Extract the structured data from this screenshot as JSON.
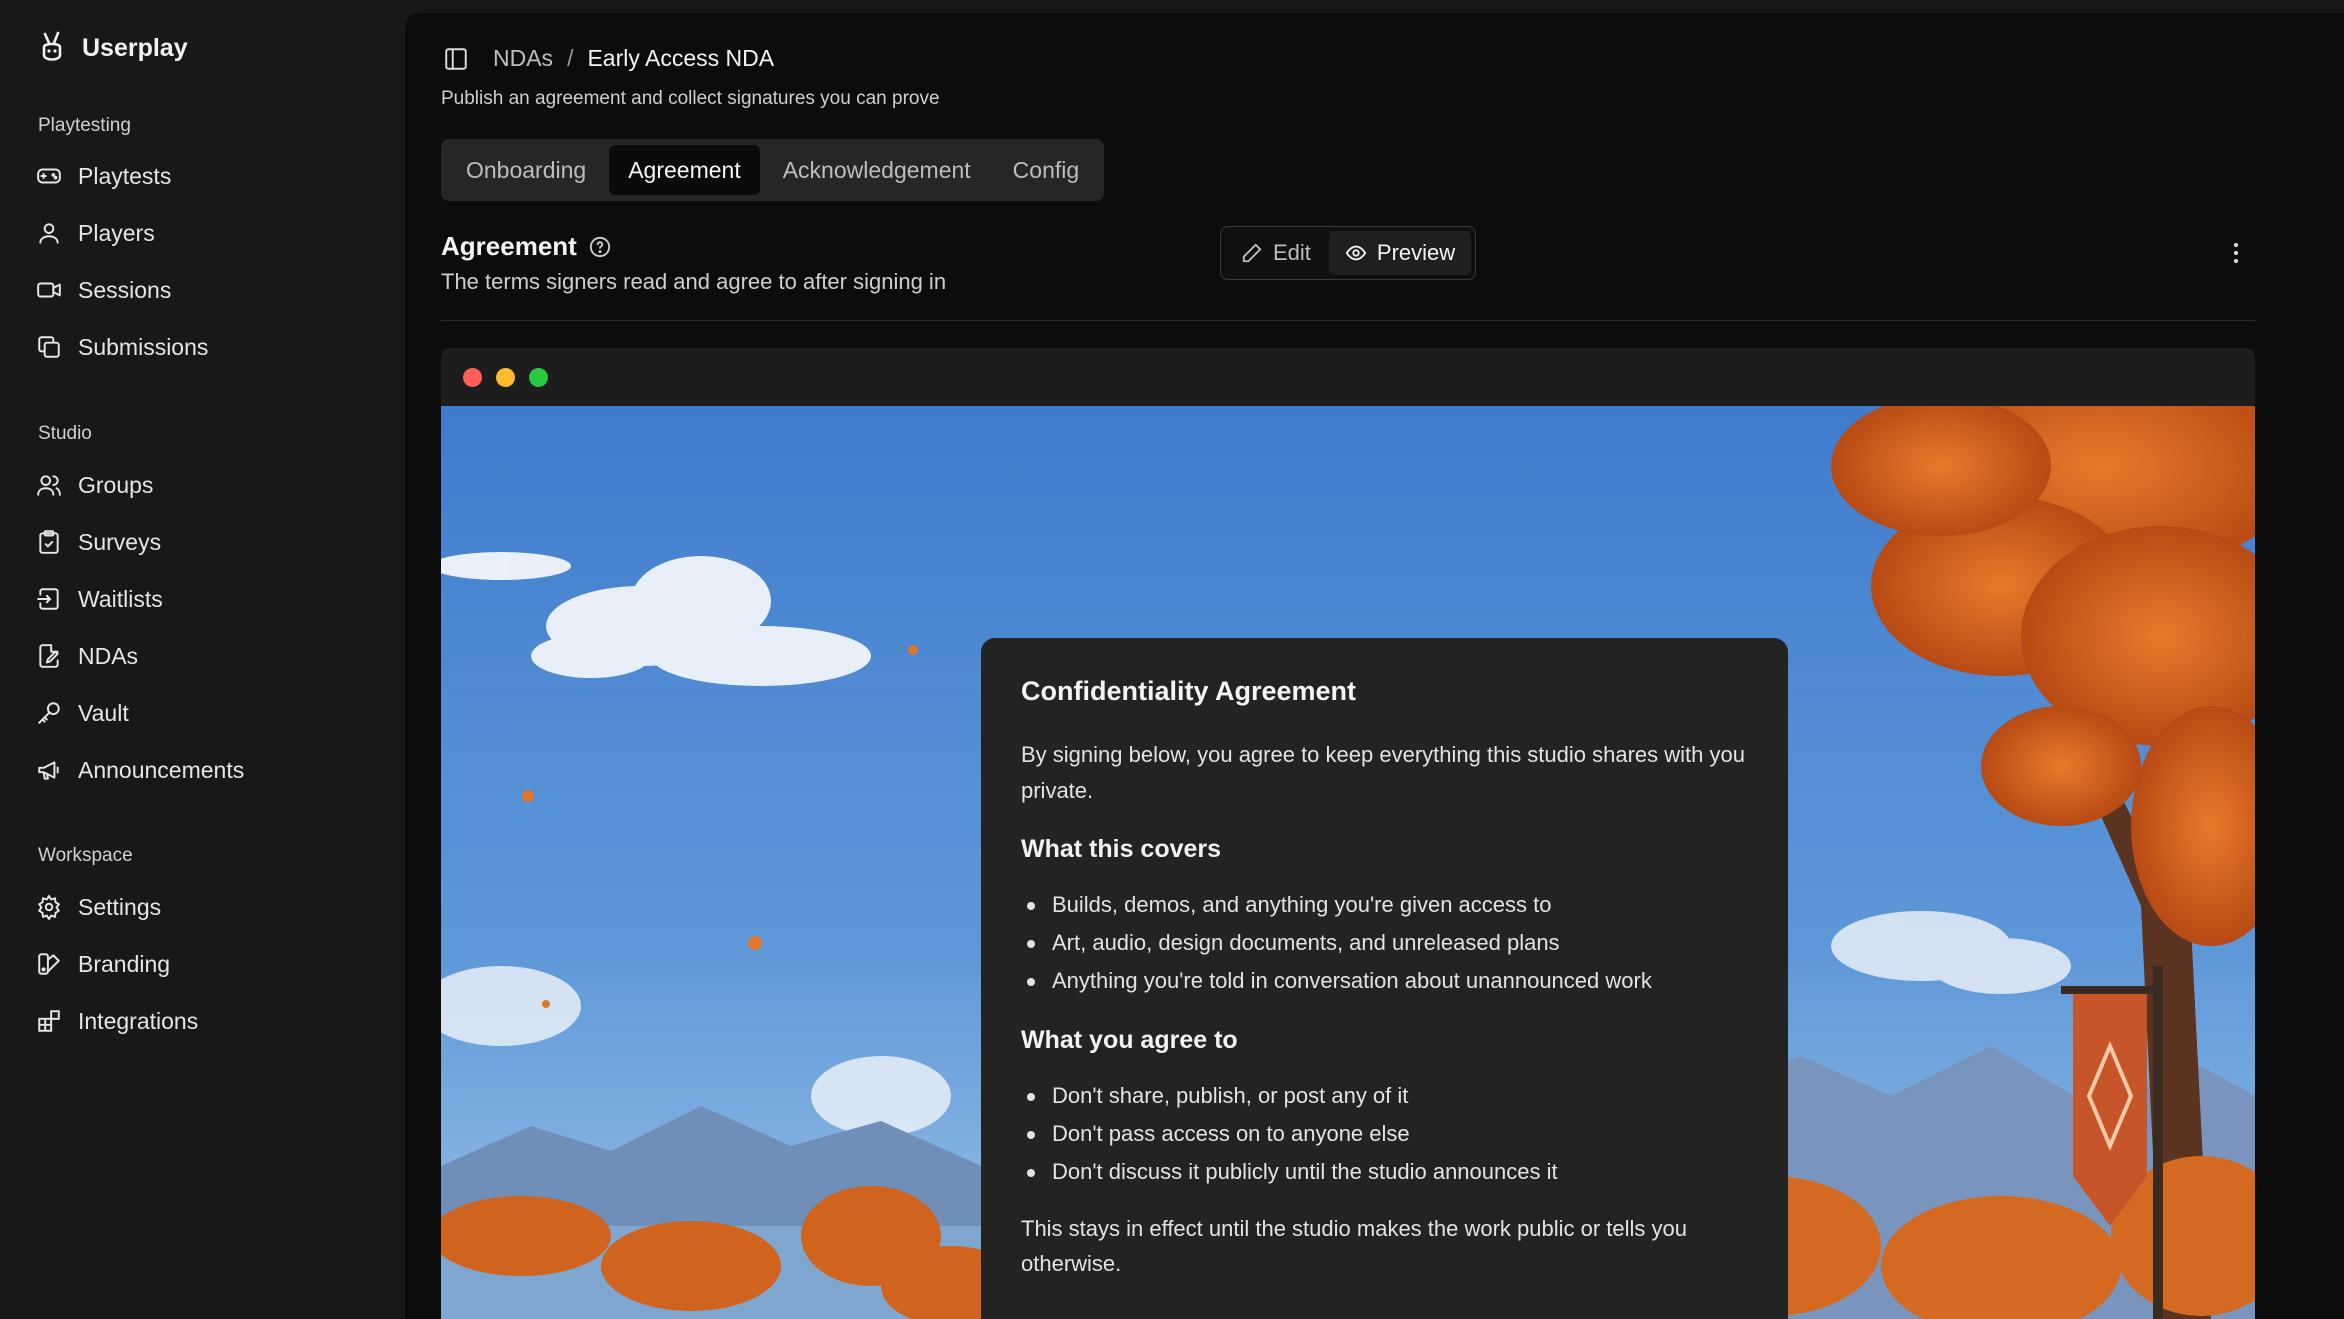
{
  "app": {
    "name": "Userplay"
  },
  "sidebar": {
    "sections": [
      {
        "label": "Playtesting",
        "items": [
          {
            "label": "Playtests",
            "icon": "gamepad-icon"
          },
          {
            "label": "Players",
            "icon": "user-icon"
          },
          {
            "label": "Sessions",
            "icon": "video-icon"
          },
          {
            "label": "Submissions",
            "icon": "copy-icon"
          }
        ]
      },
      {
        "label": "Studio",
        "items": [
          {
            "label": "Groups",
            "icon": "users-icon"
          },
          {
            "label": "Surveys",
            "icon": "clipboard-icon"
          },
          {
            "label": "Waitlists",
            "icon": "waitlist-icon"
          },
          {
            "label": "NDAs",
            "icon": "file-signature-icon"
          },
          {
            "label": "Vault",
            "icon": "key-icon"
          },
          {
            "label": "Announcements",
            "icon": "megaphone-icon"
          }
        ]
      },
      {
        "label": "Workspace",
        "items": [
          {
            "label": "Settings",
            "icon": "gear-icon"
          },
          {
            "label": "Branding",
            "icon": "palette-icon"
          },
          {
            "label": "Integrations",
            "icon": "blocks-icon"
          }
        ]
      }
    ]
  },
  "header": {
    "breadcrumb": {
      "parent": "NDAs",
      "separator": "/",
      "current": "Early Access NDA"
    },
    "subtitle": "Publish an agreement and collect signatures you can prove"
  },
  "tabs": [
    {
      "label": "Onboarding",
      "active": false
    },
    {
      "label": "Agreement",
      "active": true
    },
    {
      "label": "Acknowledgement",
      "active": false
    },
    {
      "label": "Config",
      "active": false
    }
  ],
  "section": {
    "title": "Agreement",
    "description": "The terms signers read and agree to after signing in"
  },
  "mode": {
    "edit_label": "Edit",
    "preview_label": "Preview",
    "active": "preview"
  },
  "window_dots": {
    "close": "#ff5f57",
    "minimize": "#febc2e",
    "maximize": "#28c840"
  },
  "document": {
    "title": "Confidentiality Agreement",
    "intro": "By signing below, you agree to keep everything this studio shares with you private.",
    "covers_heading": "What this covers",
    "covers": [
      "Builds, demos, and anything you're given access to",
      "Art, audio, design documents, and unreleased plans",
      "Anything you're told in conversation about unannounced work"
    ],
    "agree_heading": "What you agree to",
    "agree": [
      "Don't share, publish, or post any of it",
      "Don't pass access on to anyone else",
      "Don't discuss it publicly until the studio announces it"
    ],
    "closing": "This stays in effect until the studio makes the work public or tells you otherwise."
  },
  "colors": {
    "sidebar_bg": "#181818",
    "main_bg": "#0c0c0c",
    "card_bg": "#232323",
    "sky": "#4a86cf",
    "foliage": "#d7621f"
  }
}
